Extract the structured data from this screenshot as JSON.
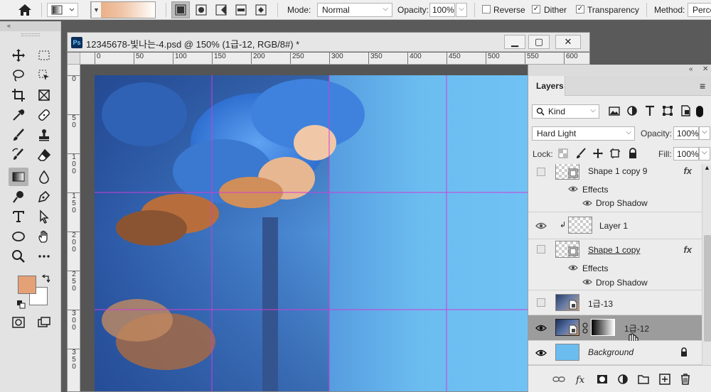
{
  "optionsBar": {
    "mode_label": "Mode:",
    "mode_value": "Normal",
    "opacity_label": "Opacity:",
    "opacity_value": "100%",
    "reverse_label": "Reverse",
    "dither_label": "Dither",
    "transparency_label": "Transparency",
    "method_label": "Method:",
    "method_value": "Perce",
    "reverse_checked": false,
    "dither_checked": true,
    "transparency_checked": true
  },
  "toolbox": {
    "collapse_glyph": "«",
    "foreground_color": "#e5a176",
    "background_color": "#ffffff"
  },
  "document": {
    "badge": "Ps",
    "title": "12345678-빛나는-4.psd @ 150% (1급-12, RGB/8#) *",
    "minimize_glyph": "▁",
    "restore_glyph": "▢",
    "close_glyph": "✕",
    "ruler_h": [
      "0",
      "50",
      "100",
      "150",
      "200",
      "250",
      "300",
      "350",
      "400",
      "450",
      "500",
      "550",
      "600"
    ],
    "ruler_v": [
      "0",
      "5 0",
      "1 0 0",
      "1 5 0",
      "2 0 0",
      "2 5 0",
      "3 0 0",
      "3 5 0"
    ]
  },
  "layersPanel": {
    "collapse_glyph": "«",
    "close_glyph": "✕",
    "tab_label": "Layers",
    "menu_glyph": "≡",
    "filter_kind": "Kind",
    "blend_mode": "Hard Light",
    "opacity_label": "Opacity:",
    "opacity_value": "100%",
    "lock_label": "Lock:",
    "fill_label": "Fill:",
    "fill_value": "100%",
    "layers": [
      {
        "name": "Shape 1 copy 9",
        "fx": "fx",
        "effects_label": "Effects",
        "effect": "Drop Shadow",
        "visible": false
      },
      {
        "name": "Layer 1",
        "visible": true
      },
      {
        "name": "Shape 1 copy",
        "fx": "fx",
        "effects_label": "Effects",
        "effect": "Drop Shadow",
        "visible": false
      },
      {
        "name": "1급-13",
        "visible": false
      },
      {
        "name": "1급-12",
        "visible": true,
        "selected": true
      },
      {
        "name": "Background",
        "visible": true,
        "locked": true
      }
    ]
  },
  "colors": {
    "accent_peach": "#e5a176",
    "sky_blue": "#6bbdf0",
    "guide_magenta": "#d03cd6"
  }
}
